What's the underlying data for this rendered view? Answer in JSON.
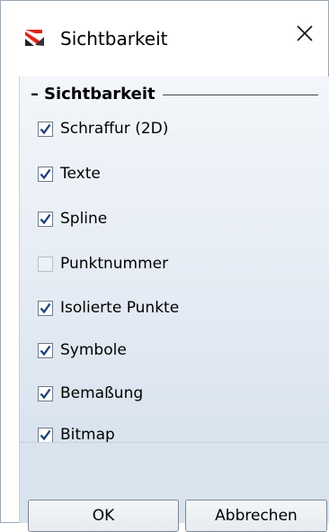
{
  "window": {
    "title": "Sichtbarkeit",
    "app_icon": "app-logo-icon",
    "close_icon": "close-icon"
  },
  "group": {
    "dash": "–",
    "title": "Sichtbarkeit"
  },
  "options": [
    {
      "label": "Schraffur (2D)",
      "checked": true
    },
    {
      "label": "Texte",
      "checked": true
    },
    {
      "label": "Spline",
      "checked": true
    },
    {
      "label": "Punktnummer",
      "checked": false
    },
    {
      "label": "Isolierte Punkte",
      "checked": true
    },
    {
      "label": "Symbole",
      "checked": true
    },
    {
      "label": "Bemaßung",
      "checked": true
    },
    {
      "label": "Bitmap",
      "checked": true
    }
  ],
  "buttons": {
    "ok": "OK",
    "cancel": "Abbrechen"
  },
  "colors": {
    "check_mark": "#1f3f7a",
    "panel_top": "#f3f6fa",
    "panel_bottom": "#d9e3ee"
  }
}
